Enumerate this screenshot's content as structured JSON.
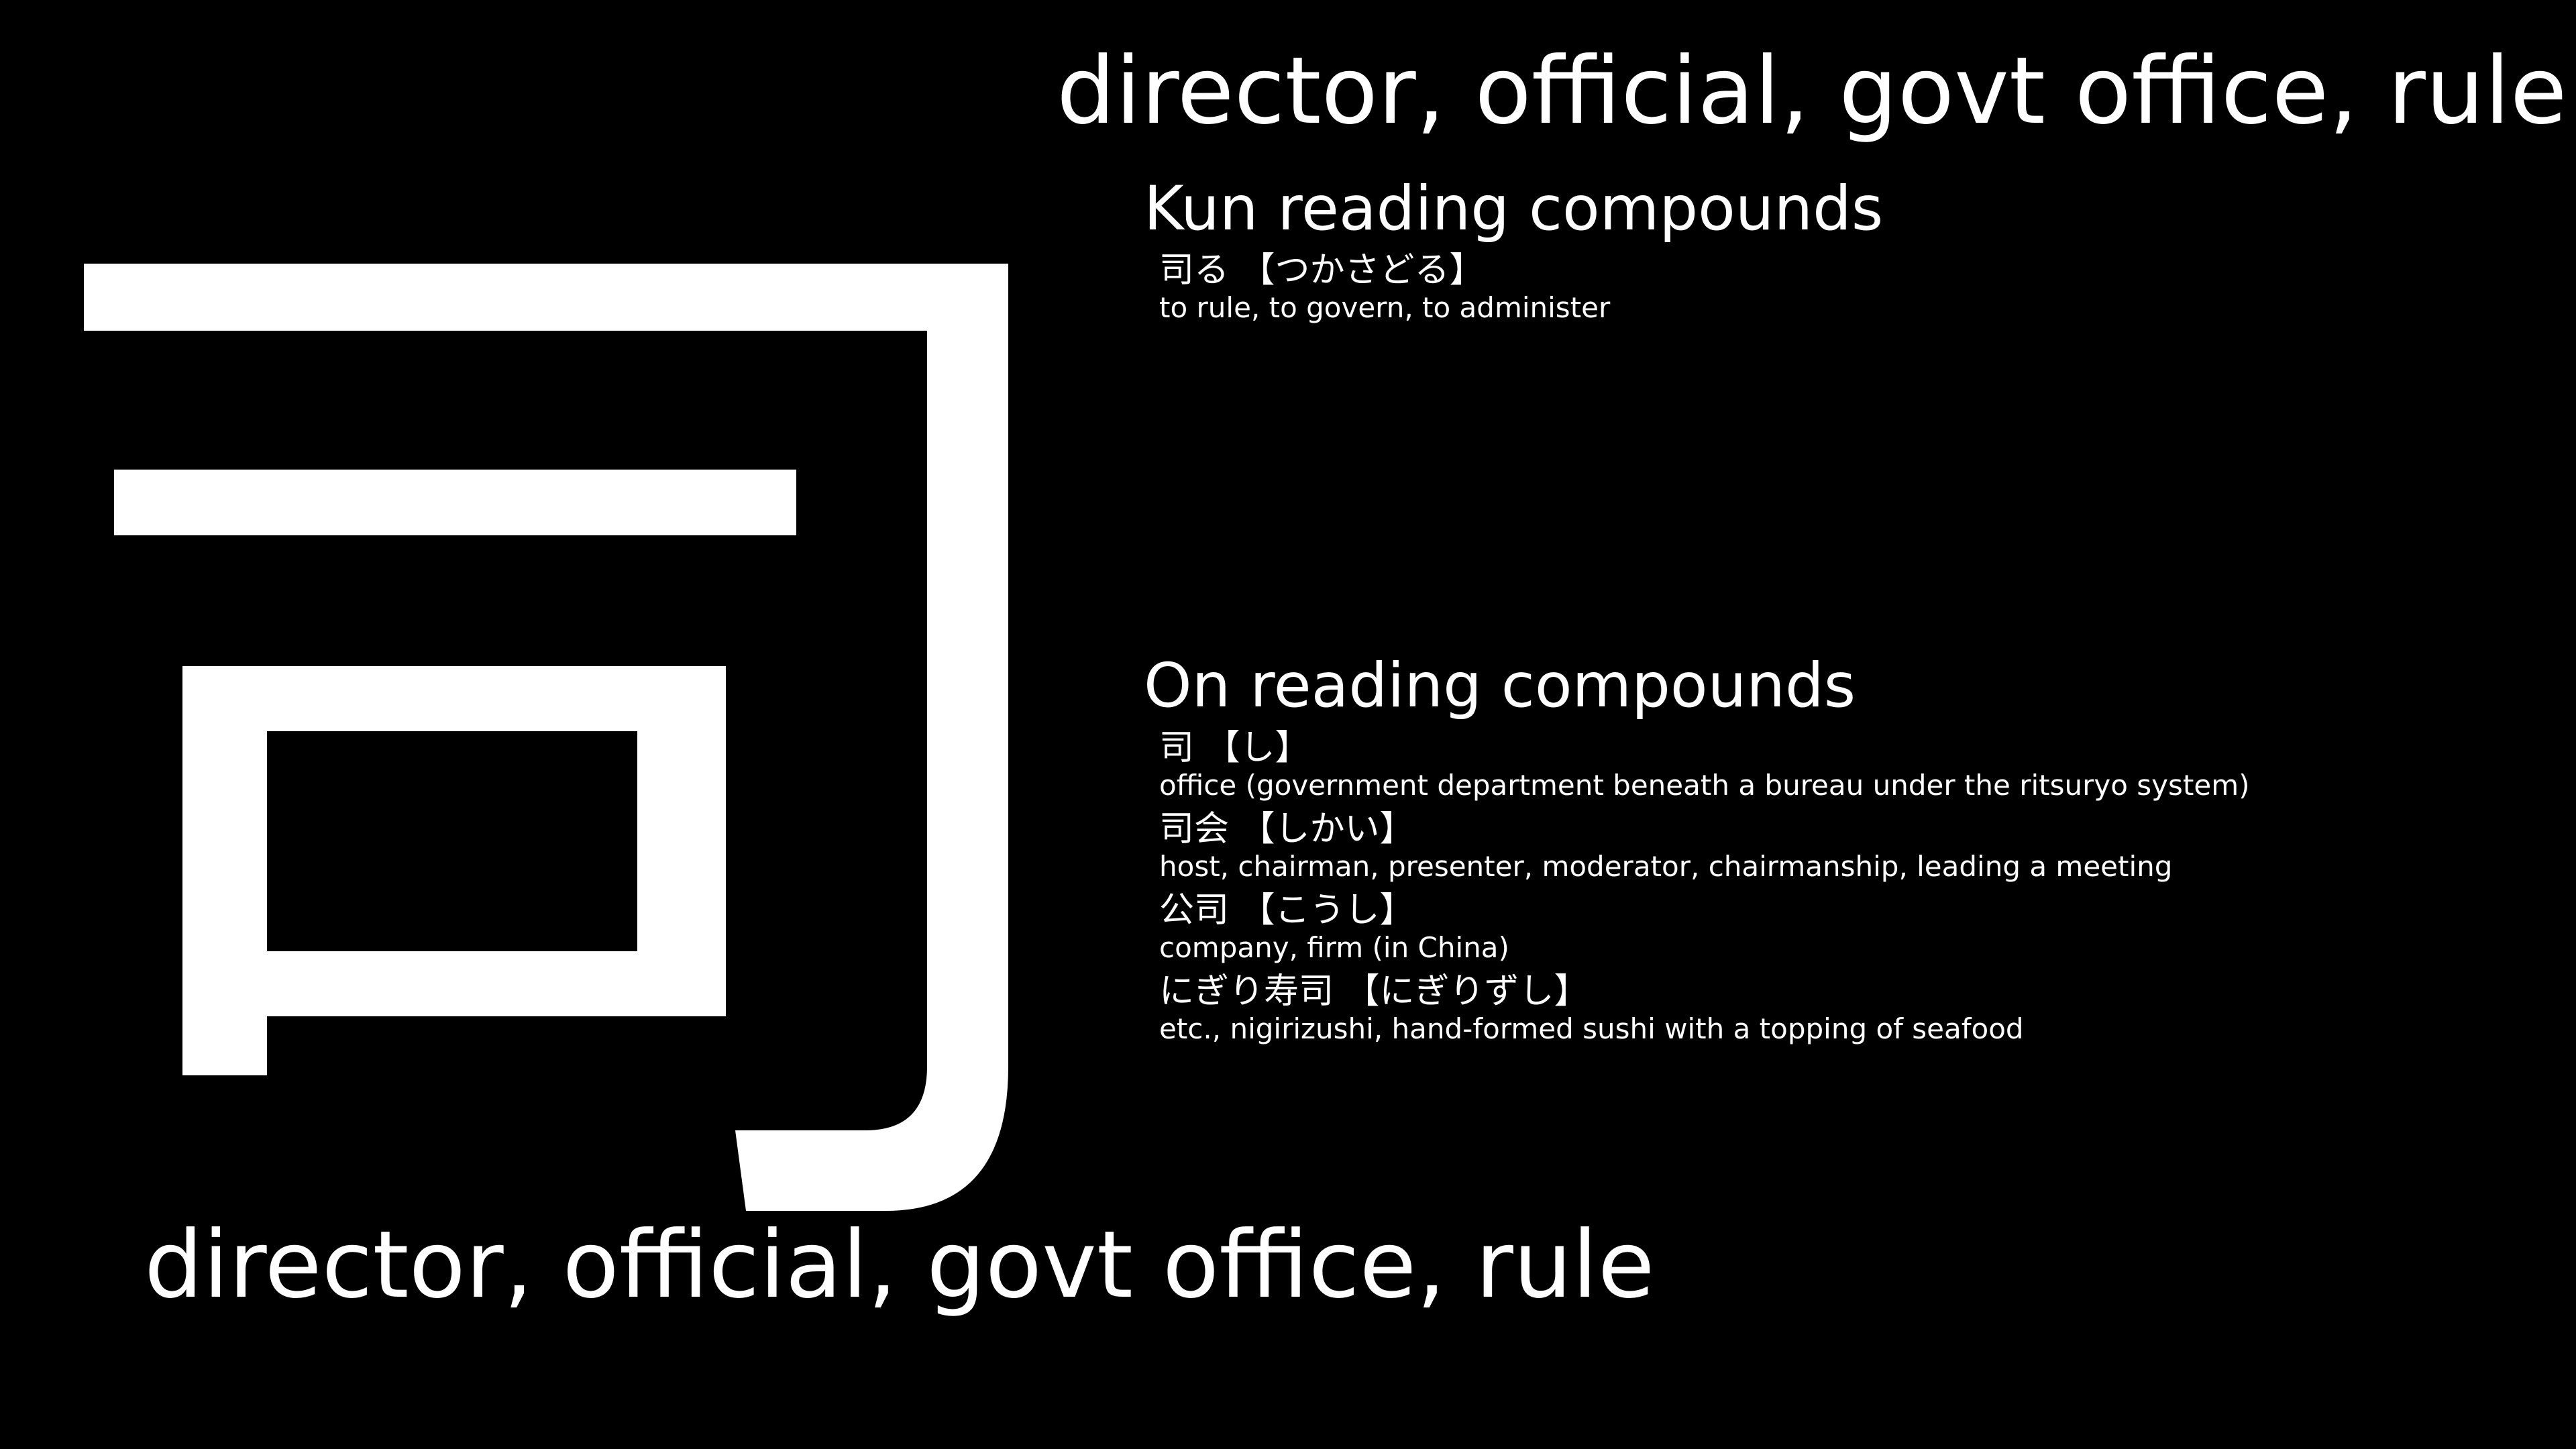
{
  "kanji": {
    "character": "司",
    "color": "#ffffff"
  },
  "meaning_top": "director, official, govt office, rule",
  "meaning_bottom": "director, official, govt office, rule",
  "kun_section": {
    "heading": "Kun reading compounds",
    "compounds": [
      {
        "word": "司る 【つかさどる】",
        "gloss": "to rule, to govern, to administer"
      }
    ]
  },
  "on_section": {
    "heading": "On reading compounds",
    "compounds": [
      {
        "word": "司 【し】",
        "gloss": "office (government department beneath a bureau under the ritsuryo system)"
      },
      {
        "word": "司会 【しかい】",
        "gloss": "host, chairman, presenter, moderator, chairmanship, leading a meeting"
      },
      {
        "word": "公司 【こうし】",
        "gloss": "company, firm (in China)"
      },
      {
        "word": "にぎり寿司 【にぎりずし】",
        "gloss": "etc., nigirizushi, hand-formed sushi with a topping of seafood"
      }
    ]
  },
  "colors": {
    "background": "#000000",
    "text": "#ffffff"
  }
}
